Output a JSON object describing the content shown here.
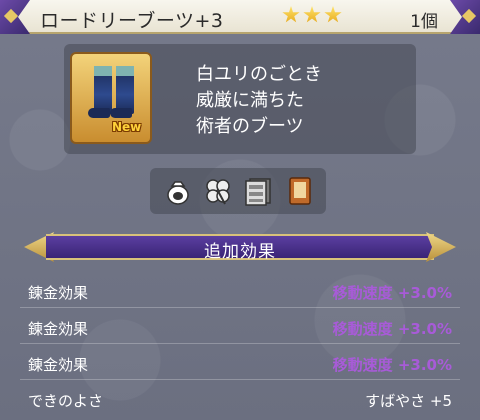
{
  "header": {
    "item_name": "ロードリーブーツ+3",
    "star_count": 3,
    "count": "1個"
  },
  "item": {
    "icon": "boots-icon",
    "badge": "New",
    "description": [
      "白ユリのごとき",
      "威厳に満ちた",
      "術者のブーツ"
    ]
  },
  "tools": [
    {
      "icon": "bag-icon"
    },
    {
      "icon": "clover-icon"
    },
    {
      "icon": "drawers-icon"
    },
    {
      "icon": "book-icon"
    }
  ],
  "bonus": {
    "title": "追加効果",
    "rows": [
      {
        "label": "錬金効果",
        "value": "移動速度 +3.0%"
      },
      {
        "label": "錬金効果",
        "value": "移動速度 +3.0%"
      },
      {
        "label": "錬金効果",
        "value": "移動速度 +3.0%"
      }
    ]
  },
  "quality": {
    "label": "できのよさ",
    "value": "すばやさ +5"
  },
  "colors": {
    "bonus_value": "#a85bd8",
    "banner": "#4a2f8c"
  }
}
